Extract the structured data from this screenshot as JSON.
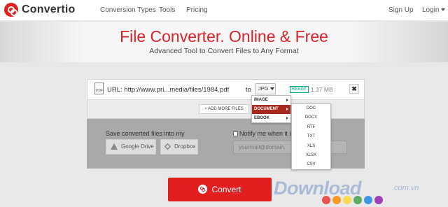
{
  "header": {
    "logo_text": "Convertio",
    "nav": [
      "Conversion Types",
      "Tools",
      "Pricing"
    ],
    "signup": "Sign Up",
    "login": "Login"
  },
  "hero": {
    "title": "File Converter. Online & Free",
    "subtitle": "Advanced Tool to Convert Files to Any Format"
  },
  "file": {
    "url_label": "URL: http://www.pri...media/files/1984.pdf",
    "to_label": "to",
    "format": "JPG",
    "status": "READY",
    "size": "1.37 MB",
    "close": "✖",
    "icon_text": "PDF"
  },
  "add_more": "+ ADD MORE FILES",
  "save": {
    "label": "Save converted files into my",
    "google_drive": "Google Drive",
    "dropbox": "Dropbox"
  },
  "notify": {
    "label": "Notify me when it is",
    "placeholder": "yourmail@domain."
  },
  "dropdown": {
    "categories": [
      "IMAGE",
      "DOCUMENT",
      "EBOOK"
    ],
    "active_category": "DOCUMENT",
    "formats": [
      "DOC",
      "DOCX",
      "RTF",
      "TXT",
      "XLS",
      "XLSX",
      "CSV"
    ]
  },
  "convert_label": "Convert",
  "watermark": {
    "text": "Download",
    "domain": ".com.vn",
    "dot_colors": [
      "#e53935",
      "#fb8c00",
      "#fdd835",
      "#43a047",
      "#1e88e5",
      "#8e24aa"
    ]
  },
  "colors": {
    "brand_red": "#e0211d",
    "title_red": "#d8232a",
    "dropdown_active": "#a82a1e"
  }
}
